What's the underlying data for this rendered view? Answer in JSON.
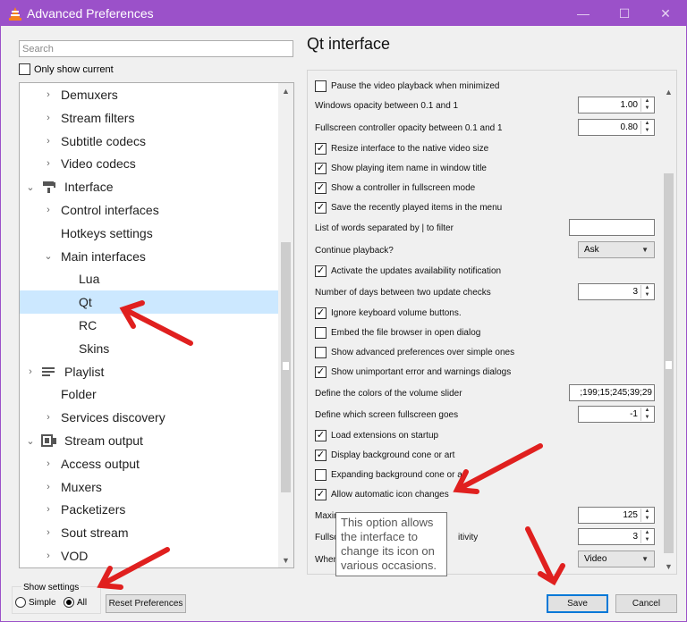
{
  "window": {
    "title": "Advanced Preferences",
    "icon": "vlc-cone-icon",
    "controls": {
      "minimize": "—",
      "maximize": "☐",
      "close": "✕"
    }
  },
  "search": {
    "placeholder": "Search"
  },
  "only_show_current": {
    "label": "Only show current",
    "checked": false
  },
  "tree": {
    "selected": "Qt",
    "items": [
      {
        "label": "Demuxers",
        "level": 1,
        "arrow": "›"
      },
      {
        "label": "Stream filters",
        "level": 1,
        "arrow": "›"
      },
      {
        "label": "Subtitle codecs",
        "level": 1,
        "arrow": "›"
      },
      {
        "label": "Video codecs",
        "level": 1,
        "arrow": "›"
      },
      {
        "label": "Interface",
        "level": 0,
        "arrow": "⌄",
        "icon": "paint-roller-icon"
      },
      {
        "label": "Control interfaces",
        "level": 1,
        "arrow": "›"
      },
      {
        "label": "Hotkeys settings",
        "level": 1,
        "arrow": ""
      },
      {
        "label": "Main interfaces",
        "level": 1,
        "arrow": "⌄"
      },
      {
        "label": "Lua",
        "level": 2,
        "arrow": ""
      },
      {
        "label": "Qt",
        "level": 2,
        "arrow": ""
      },
      {
        "label": "RC",
        "level": 2,
        "arrow": ""
      },
      {
        "label": "Skins",
        "level": 2,
        "arrow": ""
      },
      {
        "label": "Playlist",
        "level": 0,
        "arrow": "›",
        "icon": "playlist-icon"
      },
      {
        "label": "Folder",
        "level": 1,
        "arrow": ""
      },
      {
        "label": "Services discovery",
        "level": 1,
        "arrow": "›"
      },
      {
        "label": "Stream output",
        "level": 0,
        "arrow": "⌄",
        "icon": "stream-output-icon"
      },
      {
        "label": "Access output",
        "level": 1,
        "arrow": "›"
      },
      {
        "label": "Muxers",
        "level": 1,
        "arrow": "›"
      },
      {
        "label": "Packetizers",
        "level": 1,
        "arrow": "›"
      },
      {
        "label": "Sout stream",
        "level": 1,
        "arrow": "›"
      },
      {
        "label": "VOD",
        "level": 1,
        "arrow": "›"
      }
    ]
  },
  "panel": {
    "title": "Qt interface",
    "rows": [
      {
        "type": "checkbox",
        "label": "Pause the video playback when minimized",
        "checked": false
      },
      {
        "type": "spin",
        "label": "Windows opacity between 0.1 and 1",
        "value": "1.00"
      },
      {
        "type": "spin",
        "label": "Fullscreen controller opacity between 0.1 and 1",
        "value": "0.80"
      },
      {
        "type": "checkbox",
        "label": "Resize interface to the native video size",
        "checked": true
      },
      {
        "type": "checkbox",
        "label": "Show playing item name in window title",
        "checked": true
      },
      {
        "type": "checkbox",
        "label": "Show a controller in fullscreen mode",
        "checked": true
      },
      {
        "type": "checkbox",
        "label": "Save the recently played items in the menu",
        "checked": true
      },
      {
        "type": "text",
        "label": "List of words separated by | to filter",
        "value": ""
      },
      {
        "type": "combo",
        "label": "Continue playback?",
        "value": "Ask"
      },
      {
        "type": "checkbox",
        "label": "Activate the updates availability notification",
        "checked": true
      },
      {
        "type": "spin",
        "label": "Number of days between two update checks",
        "value": "3"
      },
      {
        "type": "checkbox",
        "label": "Ignore keyboard volume buttons.",
        "checked": true
      },
      {
        "type": "checkbox",
        "label": "Embed the file browser in open dialog",
        "checked": false
      },
      {
        "type": "checkbox",
        "label": "Show advanced preferences over simple ones",
        "checked": false
      },
      {
        "type": "checkbox",
        "label": "Show unimportant error and warnings dialogs",
        "checked": true
      },
      {
        "type": "text",
        "label": "Define the colors of the volume slider",
        "value": ";199;15;245;39;29"
      },
      {
        "type": "spin",
        "label": "Define which screen fullscreen goes",
        "value": "-1"
      },
      {
        "type": "checkbox",
        "label": "Load extensions on startup",
        "checked": true
      },
      {
        "type": "checkbox",
        "label": "Display background cone or art",
        "checked": true
      },
      {
        "type": "checkbox",
        "label": "Expanding background cone or a",
        "checked": false
      },
      {
        "type": "checkbox",
        "label": "Allow automatic icon changes",
        "checked": true
      },
      {
        "type": "spin",
        "label": "Maxim",
        "value": "125"
      },
      {
        "type": "spin",
        "label": "Fullsc",
        "label_tail": "itivity",
        "value": "3"
      },
      {
        "type": "combo",
        "label": "When",
        "value": "Video"
      }
    ]
  },
  "tooltip": "This option allows the interface to change its icon on various occasions.",
  "show_settings": {
    "legend": "Show settings",
    "options": [
      "Simple",
      "All"
    ],
    "selected": "All"
  },
  "buttons": {
    "reset": "Reset Preferences",
    "save": "Save",
    "cancel": "Cancel"
  },
  "colors": {
    "titlebar": "#9b51c9",
    "selection": "#cce8ff",
    "annotation_arrow": "#e0201f"
  }
}
